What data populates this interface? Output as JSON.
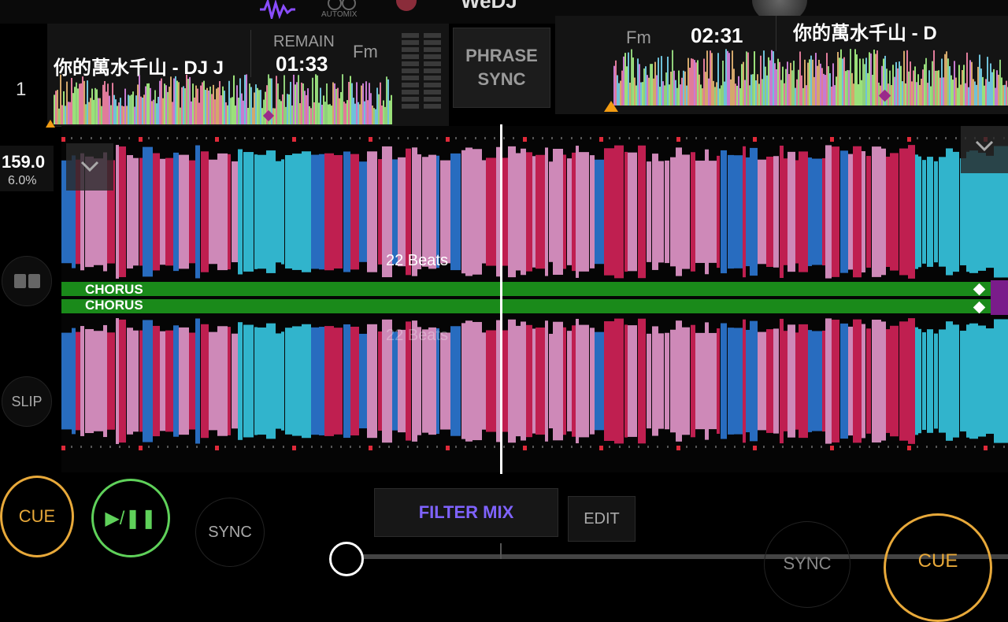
{
  "top": {
    "automix_label": "AUTOMIX",
    "logo_partial": "WeDJ"
  },
  "deck_a": {
    "number": "1",
    "title": "你的萬水千山 - DJ J",
    "remain_label": "REMAIN",
    "remain_time": "01:33",
    "key": "Fm",
    "bpm": "159.0",
    "pitch": "6.0%"
  },
  "deck_b": {
    "title": "你的萬水千山 - D",
    "time": "02:31",
    "key": "Fm"
  },
  "center": {
    "phrase_sync": "PHRASE SYNC",
    "beats_label": "22 Beats",
    "beats_label_dim": "22 Beats",
    "filter_mix": "FILTER MIX",
    "edit": "EDIT"
  },
  "phrase": {
    "top_label": "CHORUS",
    "bottom_label": "CHORUS"
  },
  "left_controls": {
    "slip": "SLIP",
    "cue": "CUE",
    "play_pause": "▶/❚❚",
    "sync": "SYNC"
  },
  "right_controls": {
    "sync": "SYNC",
    "cue": "CUE"
  },
  "colors": {
    "accent_cue": "#e8a93a",
    "accent_play": "#5fd15a",
    "filter_purple": "#7f63ff",
    "phrase_green": "#1a8a1a",
    "wave_pink": "#f2a1d8",
    "wave_red": "#e0245e",
    "wave_cyan": "#39d3f0",
    "wave_blue": "#2f7fe0"
  }
}
